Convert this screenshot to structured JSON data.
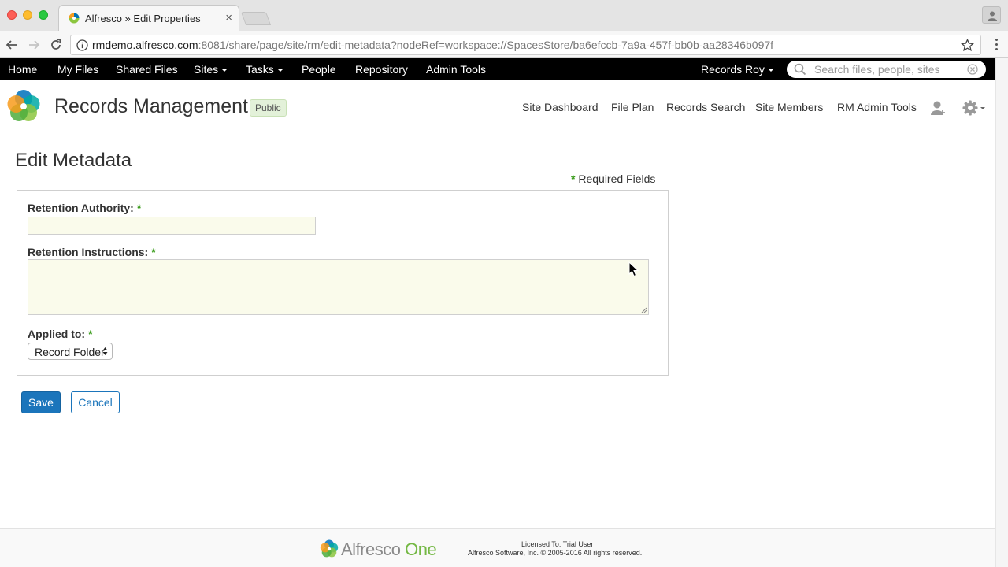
{
  "browser": {
    "tab_title": "Alfresco » Edit Properties",
    "url_host": "rmdemo.alfresco.com",
    "url_rest": ":8081/share/page/site/rm/edit-metadata?nodeRef=workspace://SpacesStore/ba6efccb-7a9a-457f-bb0b-aa28346b097f"
  },
  "header": {
    "nav": [
      "Home",
      "My Files",
      "Shared Files",
      "Sites",
      "Tasks",
      "People",
      "Repository",
      "Admin Tools"
    ],
    "user": "Records Roy",
    "search_placeholder": "Search files, people, sites"
  },
  "site": {
    "title": "Records Management",
    "visibility": "Public",
    "nav": [
      "Site Dashboard",
      "File Plan",
      "Records Search",
      "Site Members",
      "RM Admin Tools"
    ]
  },
  "page": {
    "title": "Edit Metadata",
    "required_note": "Required Fields",
    "required_marker": "*"
  },
  "form": {
    "retention_authority_label": "Retention Authority:",
    "retention_authority_value": "",
    "retention_instructions_label": "Retention Instructions:",
    "retention_instructions_value": "",
    "applied_to_label": "Applied to:",
    "applied_to_value": "Record Folder"
  },
  "buttons": {
    "save": "Save",
    "cancel": "Cancel"
  },
  "footer": {
    "brand_name": "Alfresco",
    "brand_product": "One",
    "licensed": "Licensed To: Trial User",
    "copyright": "Alfresco Software, Inc. © 2005-2016 All rights reserved."
  },
  "colors": {
    "header_bg": "#000000",
    "primary_button": "#1b75bb",
    "required_star": "#3a9c1b",
    "field_bg": "#fafbeb"
  }
}
